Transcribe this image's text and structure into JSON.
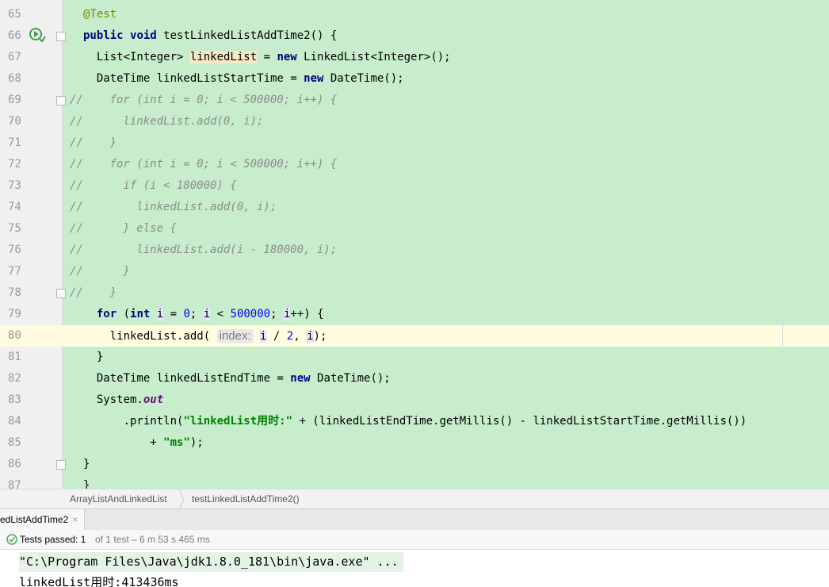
{
  "editor": {
    "current_line": "80",
    "lines": [
      {
        "no": "65",
        "tokens": [
          [
            "ann",
            "@Test"
          ]
        ]
      },
      {
        "no": "66",
        "tokens": [
          [
            "kw",
            "public"
          ],
          [
            "",
            " "
          ],
          [
            "kw",
            "void"
          ],
          [
            "",
            " testLinkedListAddTime2() {"
          ]
        ]
      },
      {
        "no": "67",
        "tokens": [
          [
            "",
            "  List<Integer> "
          ],
          [
            "hl-var",
            "linkedList"
          ],
          [
            "",
            " = "
          ],
          [
            "kw",
            "new"
          ],
          [
            "",
            " LinkedList<Integer>();"
          ]
        ]
      },
      {
        "no": "68",
        "tokens": [
          [
            "",
            "  DateTime linkedListStartTime = "
          ],
          [
            "kw",
            "new"
          ],
          [
            "",
            " DateTime();"
          ]
        ]
      },
      {
        "no": "69",
        "tokens": [
          [
            "cmt",
            "//    for (int i = 0; i < 500000; i++) {"
          ]
        ]
      },
      {
        "no": "70",
        "tokens": [
          [
            "cmt",
            "//      linkedList.add(0, i);"
          ]
        ]
      },
      {
        "no": "71",
        "tokens": [
          [
            "cmt",
            "//    }"
          ]
        ]
      },
      {
        "no": "72",
        "tokens": [
          [
            "cmt",
            "//    for (int i = 0; i < 500000; i++) {"
          ]
        ]
      },
      {
        "no": "73",
        "tokens": [
          [
            "cmt",
            "//      if (i < 180000) {"
          ]
        ]
      },
      {
        "no": "74",
        "tokens": [
          [
            "cmt",
            "//        linkedList.add(0, i);"
          ]
        ]
      },
      {
        "no": "75",
        "tokens": [
          [
            "cmt",
            "//      } else {"
          ]
        ]
      },
      {
        "no": "76",
        "tokens": [
          [
            "cmt",
            "//        linkedList.add(i - 180000, i);"
          ]
        ]
      },
      {
        "no": "77",
        "tokens": [
          [
            "cmt",
            "//      }"
          ]
        ]
      },
      {
        "no": "78",
        "tokens": [
          [
            "cmt",
            "//    }"
          ]
        ]
      },
      {
        "no": "79",
        "tokens": [
          [
            "",
            "  "
          ],
          [
            "kw",
            "for"
          ],
          [
            "",
            " ("
          ],
          [
            "kw",
            "int"
          ],
          [
            "",
            " "
          ],
          [
            "var-i",
            "i"
          ],
          [
            "",
            " = "
          ],
          [
            "num",
            "0"
          ],
          [
            "",
            "; "
          ],
          [
            "var-i",
            "i"
          ],
          [
            "",
            " < "
          ],
          [
            "num",
            "500000"
          ],
          [
            "",
            "; "
          ],
          [
            "var-i",
            "i"
          ],
          [
            "",
            "++) {"
          ]
        ]
      },
      {
        "no": "80",
        "tokens": [
          [
            "",
            "    linkedList.add( "
          ],
          [
            "hint",
            "index:"
          ],
          [
            "",
            " "
          ],
          [
            "var-i",
            "i"
          ],
          [
            "",
            " / "
          ],
          [
            "num",
            "2"
          ],
          [
            "",
            ", "
          ],
          [
            "var-i",
            "i"
          ],
          [
            "",
            ");"
          ]
        ]
      },
      {
        "no": "81",
        "tokens": [
          [
            "",
            "  }"
          ]
        ]
      },
      {
        "no": "82",
        "tokens": [
          [
            "",
            "  DateTime linkedListEndTime = "
          ],
          [
            "kw",
            "new"
          ],
          [
            "",
            " DateTime();"
          ]
        ]
      },
      {
        "no": "83",
        "tokens": [
          [
            "",
            "  System."
          ],
          [
            "static",
            "out"
          ]
        ]
      },
      {
        "no": "84",
        "tokens": [
          [
            "",
            "      .println("
          ],
          [
            "str",
            "\"linkedList用时:\""
          ],
          [
            "",
            " + (linkedListEndTime.getMillis() - linkedListStartTime.getMillis())"
          ]
        ]
      },
      {
        "no": "85",
        "tokens": [
          [
            "",
            "          + "
          ],
          [
            "str",
            "\"ms\""
          ],
          [
            "",
            ");"
          ]
        ]
      },
      {
        "no": "86",
        "tokens": [
          [
            "",
            "}"
          ]
        ]
      },
      {
        "no": "87",
        "tokens": [
          [
            "",
            "}"
          ]
        ]
      }
    ]
  },
  "breadcrumb": {
    "items": [
      "ArrayListAndLinkedList",
      "testLinkedListAddTime2()"
    ]
  },
  "run_panel": {
    "tab_label": "edListAddTime2",
    "tab_close": "×"
  },
  "status": {
    "passed_label": "Tests passed: 1",
    "detail": "of 1 test – 6 m 53 s 465 ms"
  },
  "console": {
    "command": "\"C:\\Program Files\\Java\\jdk1.8.0_181\\bin\\java.exe\" ...",
    "output": "linkedList用时:413436ms"
  },
  "colors": {
    "editor_bg": "#c7edcc",
    "current_line_bg": "#fffce0",
    "keyword": "#000080",
    "string": "#008000",
    "number": "#0000ff",
    "comment": "#8c8c8c",
    "annotation": "#808000",
    "pass_icon": "#4caf50"
  },
  "icons": {
    "run_gutter": "run-test-icon",
    "status": "check-circle-icon"
  }
}
